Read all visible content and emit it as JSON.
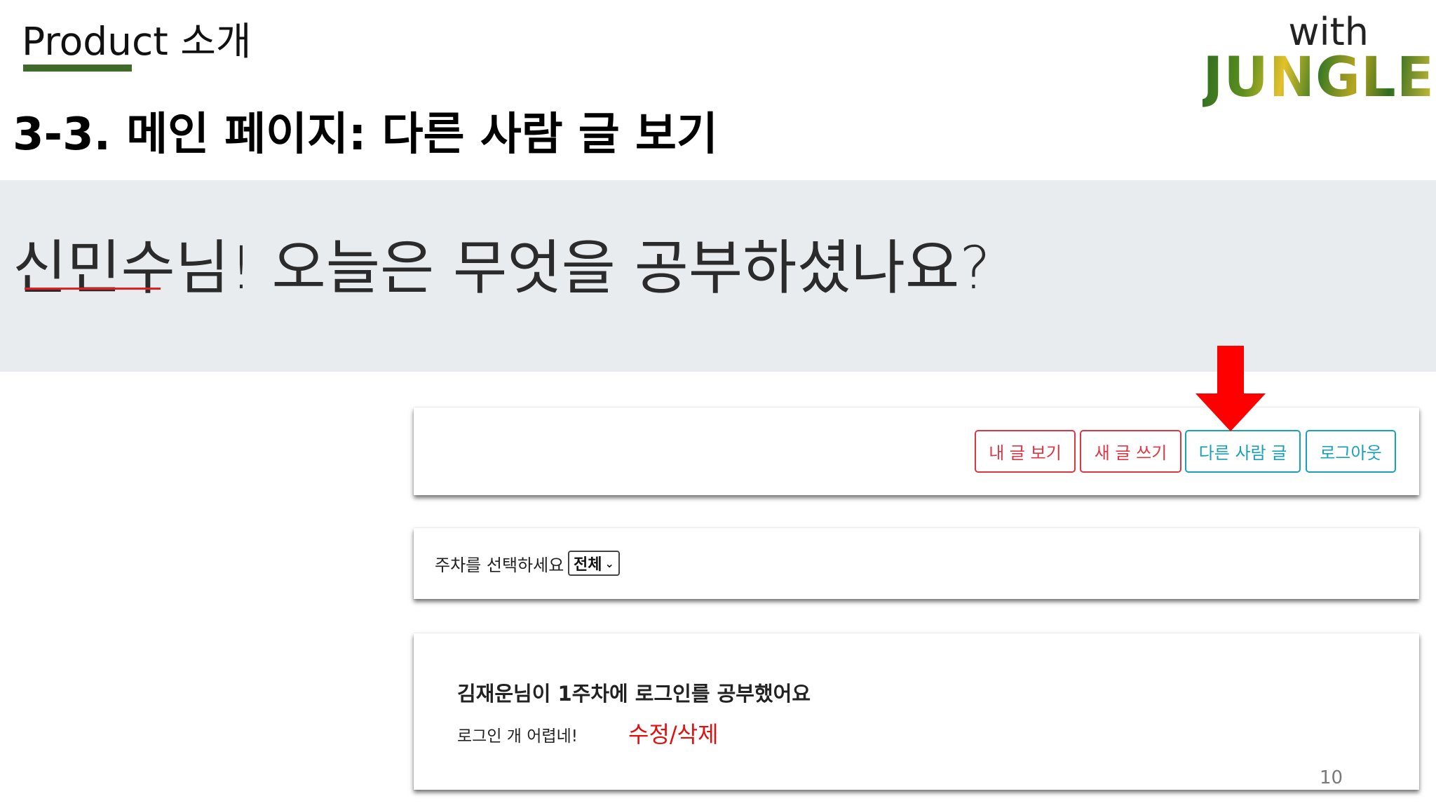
{
  "slide": {
    "section_label": "Product 소개",
    "title": "3-3. 메인 페이지: 다른 사람 글 보기",
    "logo_with": "with",
    "logo_name": "JUNGLE",
    "page_number": "10",
    "accent_color": "#3f6a2a"
  },
  "greeting": {
    "text": "신민수님! 오늘은 무엇을 공부하셨나요?"
  },
  "nav": {
    "buttons": [
      {
        "label": "내 글 보기",
        "style": "outline-red"
      },
      {
        "label": "새 글 쓰기",
        "style": "outline-red"
      },
      {
        "label": "다른 사람 글",
        "style": "outline-teal",
        "highlighted": true
      },
      {
        "label": "로그아웃",
        "style": "outline-teal"
      }
    ],
    "colors": {
      "red": "#dc3545",
      "teal": "#17a2b8"
    }
  },
  "filter": {
    "label": "주차를 선택하세요",
    "selected": "전체"
  },
  "post": {
    "title": "김재운님이 1주차에 로그인를 공부했어요",
    "body": "로그인 개 어렵네!",
    "edit_link": "수정/삭제"
  },
  "annotation": {
    "arrow_icon": "down-arrow-icon",
    "arrow_color": "#ff0000"
  }
}
